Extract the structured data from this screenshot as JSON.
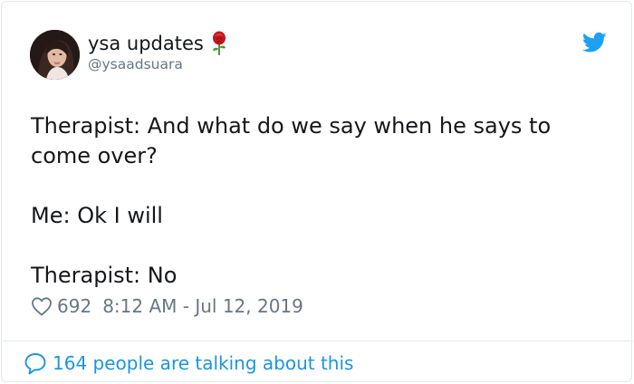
{
  "author": {
    "display_name": "ysa updates",
    "handle": "@ysaadsuara",
    "avatar_icon": "profile-photo",
    "name_emoji_icon": "rose-icon"
  },
  "brand": {
    "icon": "twitter-bird-icon",
    "color": "#1da1f2"
  },
  "tweet": {
    "lines": [
      "Therapist: And what do we say when he says to come over?",
      "Me: Ok I will",
      "Therapist: No"
    ],
    "likes": "692",
    "timestamp": "8:12 AM - Jul 12, 2019"
  },
  "footer": {
    "talking": "164 people are talking about this",
    "icon": "comment-bubble-icon",
    "color": "#1b95e0"
  }
}
